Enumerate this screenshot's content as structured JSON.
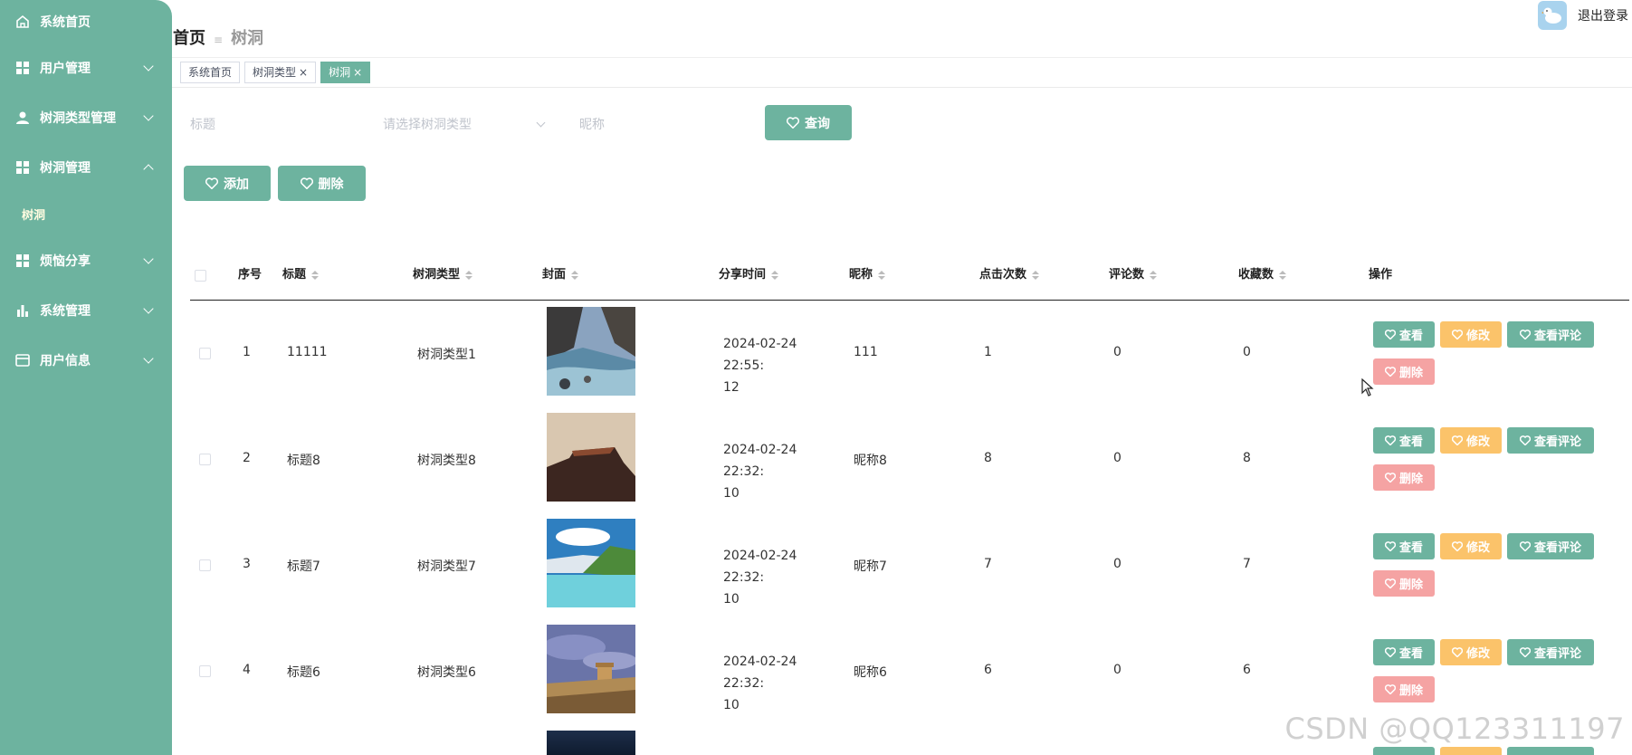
{
  "sidebar": {
    "items": [
      {
        "label": "系统首页",
        "icon": "home-icon"
      },
      {
        "label": "用户管理",
        "icon": "grid-icon"
      },
      {
        "label": "树洞类型管理",
        "icon": "user-icon"
      },
      {
        "label": "树洞管理",
        "icon": "grid-icon",
        "expanded": true,
        "children": [
          "树洞"
        ]
      },
      {
        "label": "烦恼分享",
        "icon": "grid-icon"
      },
      {
        "label": "系统管理",
        "icon": "bar-chart-icon"
      },
      {
        "label": "用户信息",
        "icon": "card-icon"
      }
    ]
  },
  "header": {
    "breadcrumb_home": "首页",
    "breadcrumb_current": "树洞",
    "logout": "退出登录"
  },
  "tabs": [
    {
      "label": "系统首页",
      "closable": false
    },
    {
      "label": "树洞类型",
      "closable": true
    },
    {
      "label": "树洞",
      "closable": true,
      "active": true
    }
  ],
  "search": {
    "title_placeholder": "标题",
    "type_placeholder": "请选择树洞类型",
    "nickname_placeholder": "昵称",
    "query_label": "查询"
  },
  "toolbar": {
    "add_label": "添加",
    "delete_label": "删除"
  },
  "table": {
    "headers": [
      "序号",
      "标题",
      "树洞类型",
      "封面",
      "分享时间",
      "昵称",
      "点击次数",
      "评论数",
      "收藏数",
      "操作"
    ],
    "rows": [
      {
        "index": "1",
        "title": "11111",
        "type": "树洞类型1",
        "time_date": "2024-02-24 22:55:",
        "time_sec": "12",
        "nickname": "111",
        "clicks": "1",
        "comments": "0",
        "favorites": "0",
        "cover": "mountain-river"
      },
      {
        "index": "2",
        "title": "标题8",
        "type": "树洞类型8",
        "time_date": "2024-02-24 22:32:",
        "time_sec": "10",
        "nickname": "昵称8",
        "clicks": "8",
        "comments": "0",
        "favorites": "8",
        "cover": "cliff"
      },
      {
        "index": "3",
        "title": "标题7",
        "type": "树洞类型7",
        "time_date": "2024-02-24 22:32:",
        "time_sec": "10",
        "nickname": "昵称7",
        "clicks": "7",
        "comments": "0",
        "favorites": "7",
        "cover": "lake"
      },
      {
        "index": "4",
        "title": "标题6",
        "type": "树洞类型6",
        "time_date": "2024-02-24 22:32:",
        "time_sec": "10",
        "nickname": "昵称6",
        "clicks": "6",
        "comments": "0",
        "favorites": "6",
        "cover": "desert-castle"
      }
    ],
    "actions": {
      "view": "查看",
      "edit": "修改",
      "comments": "查看评论",
      "delete": "删除"
    }
  },
  "watermark": "CSDN @QQ123311197",
  "colors": {
    "primary": "#6db39f",
    "warning": "#fbc36a",
    "danger": "#f5a3a3"
  }
}
